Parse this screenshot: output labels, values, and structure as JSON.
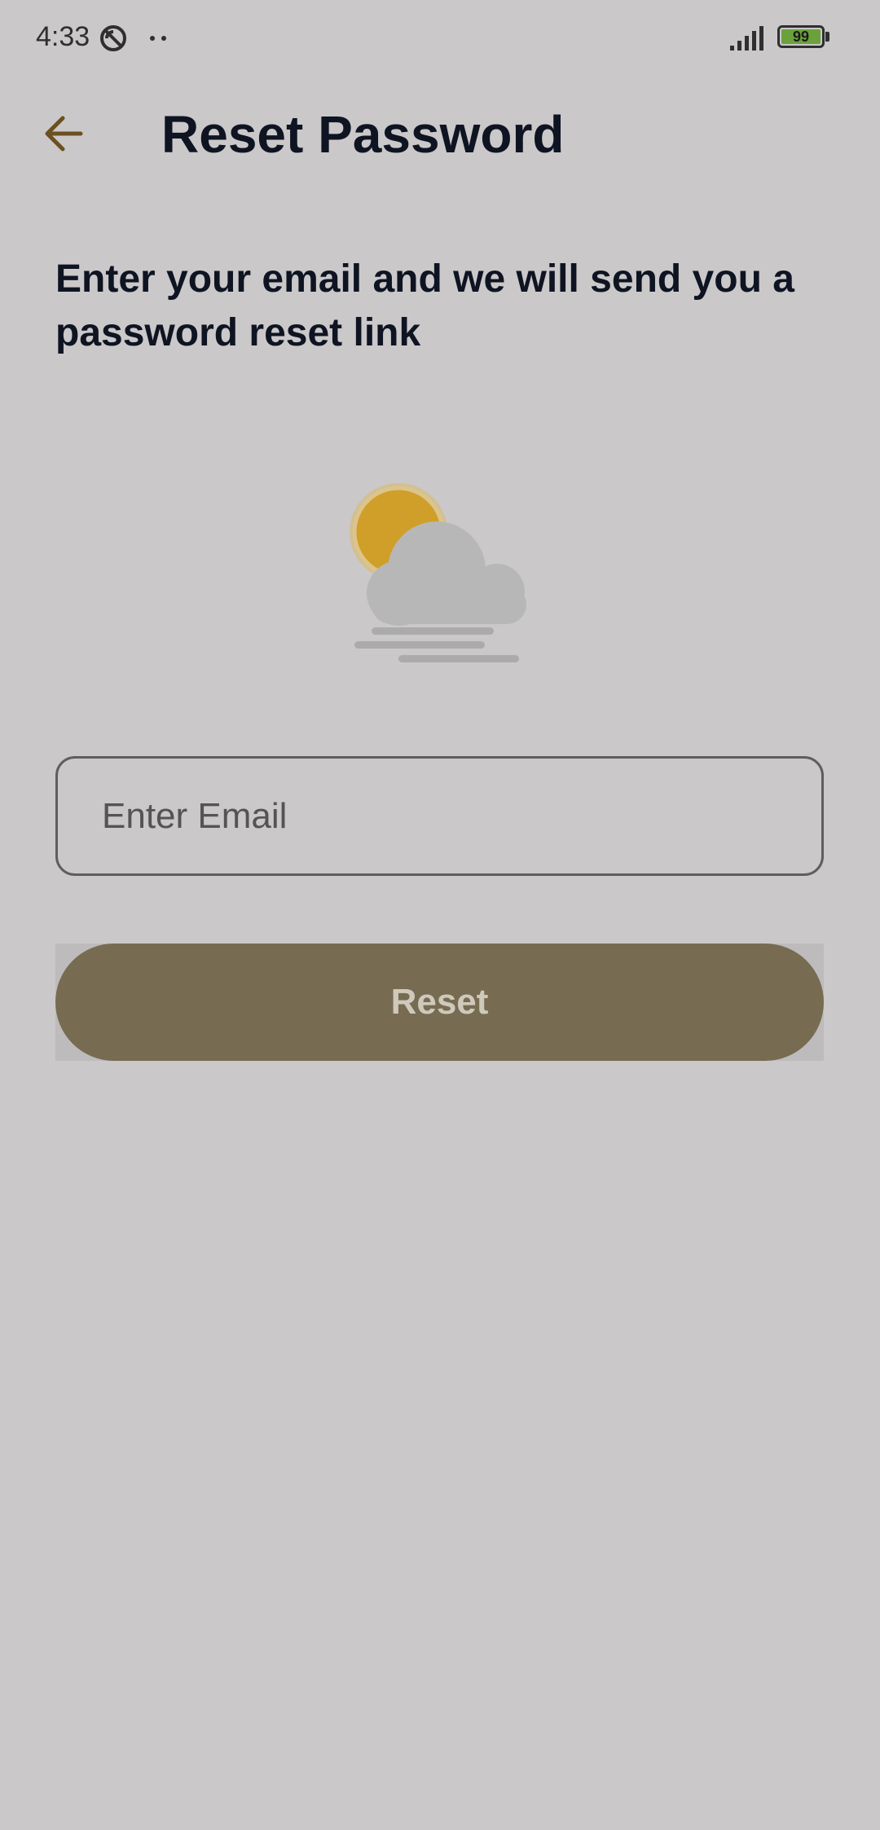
{
  "status_bar": {
    "time": "4:33",
    "battery_level": "99",
    "icons": {
      "dnd": "do-not-disturb-icon",
      "more": "more-dots-icon",
      "signal": "signal-icon",
      "battery": "battery-icon"
    },
    "battery_color": "#6aa13a"
  },
  "app_bar": {
    "back_icon": "arrow-back-icon",
    "title": "Reset Password"
  },
  "content": {
    "instruction": "Enter your email and we will send you a password reset link",
    "illustration": "sun-cloud-fog-icon",
    "email_field": {
      "placeholder": "Enter Email",
      "value": ""
    },
    "reset_label": "Reset"
  },
  "colors": {
    "background": "#cac8c9",
    "accent": "#776b51",
    "title_text": "#0f1422",
    "back_arrow": "#6b5020",
    "sun": "#cf9f2a"
  }
}
